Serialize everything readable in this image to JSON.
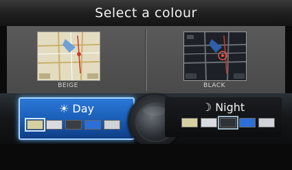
{
  "title": "Select a colour",
  "previews": [
    {
      "label": "BEIGE",
      "background": "#d9d2b6"
    },
    {
      "label": "BLACK",
      "background": "#20242a"
    }
  ],
  "day": {
    "label": "☀ Day",
    "swatches": [
      "#d6d0a0",
      "#d8dbdf",
      "#3a3e44",
      "#2c6fd6",
      "#cfd2d6"
    ],
    "selected_index": 0
  },
  "night": {
    "label": "☽ Night",
    "swatches": [
      "#d6d0a0",
      "#d8dbdf",
      "#2e3338",
      "#2c6fd6",
      "#cfd2d6"
    ],
    "selected_index": 2
  },
  "colors": {
    "accent": "#1a5fb8",
    "accent_border": "#a8d4ff"
  }
}
